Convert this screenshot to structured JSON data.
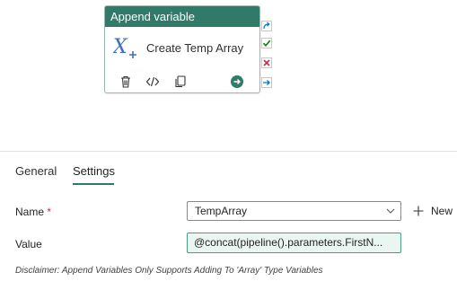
{
  "activity": {
    "type_label": "Append variable",
    "name": "Create Temp Array"
  },
  "tabs": [
    {
      "label": "General",
      "selected": false
    },
    {
      "label": "Settings",
      "selected": true
    }
  ],
  "settings": {
    "name_label": "Name",
    "required_marker": "*",
    "name_value": "TempArray",
    "new_button_label": "New",
    "value_label": "Value",
    "value_text": "@concat(pipeline().parameters.FirstN...",
    "disclaimer": "Disclaimer: Append Variables Only Supports Adding To 'Array' Type Variables"
  },
  "colors": {
    "accent": "#2f7a68",
    "success": "#107c10",
    "error": "#c4314b",
    "completion": "#0078d4",
    "value_bg": "#eaf6f2"
  },
  "icons": {
    "activity": "append-variable-icon",
    "delete": "delete-icon",
    "code": "code-icon",
    "copy": "copy-icon",
    "run": "run-arrow-icon",
    "skip": "redo-arrow-icon",
    "success": "check-icon",
    "failure": "x-icon",
    "completion": "arrow-right-icon",
    "dropdown": "chevron-down-icon",
    "add": "plus-icon"
  }
}
